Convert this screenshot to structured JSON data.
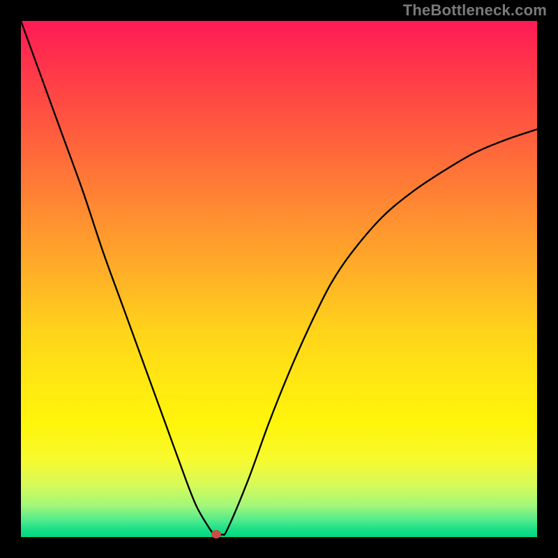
{
  "watermark_text": "TheBottleneck.com",
  "colors": {
    "page_bg": "#000000",
    "curve": "#000000",
    "marker": "#cf4a47",
    "watermark": "#7a7a7a"
  },
  "chart_data": {
    "type": "line",
    "title": "",
    "xlabel": "",
    "ylabel": "",
    "xlim": [
      0,
      100
    ],
    "ylim": [
      0,
      100
    ],
    "grid": false,
    "legend": false,
    "annotations": [],
    "series": [
      {
        "name": "bottleneck-curve",
        "x": [
          0,
          4,
          8,
          12,
          16,
          20,
          24,
          28,
          32,
          34,
          36,
          37.5,
          39,
          40,
          44,
          48,
          52,
          56,
          60,
          64,
          70,
          76,
          82,
          88,
          94,
          100
        ],
        "y": [
          100,
          89,
          78,
          67,
          55,
          44,
          33,
          22,
          11,
          6,
          2.5,
          0.5,
          0.5,
          1.5,
          11,
          22,
          32,
          41,
          49,
          55,
          62,
          67,
          71,
          74.5,
          77,
          79
        ]
      }
    ],
    "marker": {
      "x": 37.8,
      "y": 0.5
    }
  }
}
